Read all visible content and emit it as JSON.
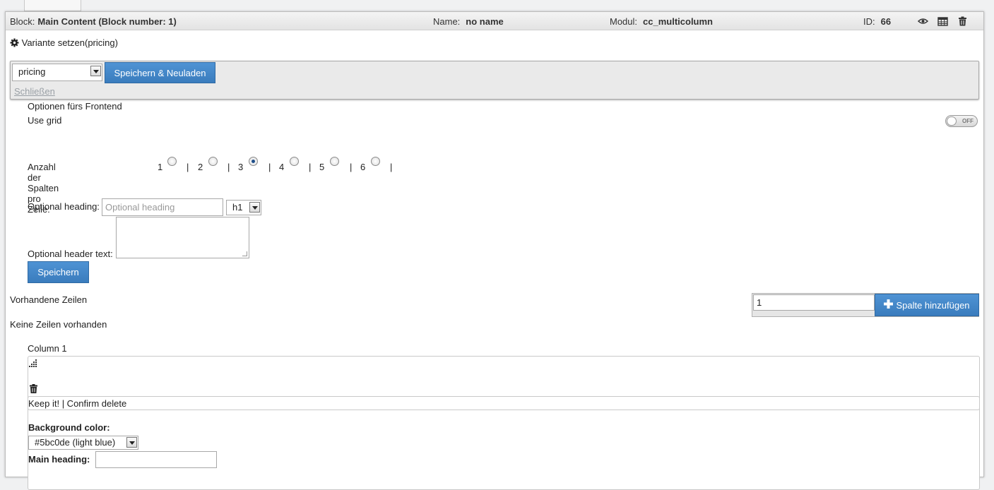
{
  "header": {
    "block_label": "Block:",
    "block_value": "Main Content (Block number: 1)",
    "name_label": "Name:",
    "name_value": "no name",
    "modul_label": "Modul:",
    "modul_value": "cc_multicolumn",
    "id_label": "ID:",
    "id_value": "66",
    "icons": [
      "eye-icon",
      "calendar-icon",
      "trash-icon"
    ]
  },
  "variant": {
    "title": "Variante setzen(pricing)",
    "selected": "pricing",
    "save_reload_label": "Speichern & Neuladen",
    "close_label": "Schließen"
  },
  "options": {
    "frontend_label": "Optionen fürs Frontend",
    "use_grid_label": "Use grid",
    "use_grid_toggle": "OFF",
    "columns_label": "Anzahl der Spalten pro Zeile:",
    "columns_options": [
      "1",
      "2",
      "3",
      "4",
      "5",
      "6"
    ],
    "columns_selected": "3",
    "separator": "|",
    "heading_label": "Optional heading:",
    "heading_placeholder": "Optional heading",
    "heading_level": "h1",
    "header_text_label": "Optional header text:",
    "save_label": "Speichern"
  },
  "rows": {
    "existing_label": "Vorhandene Zeilen",
    "none_label": "Keine Zeilen vorhanden",
    "column_count_value": "1",
    "add_column_label": "Spalte hinzufügen"
  },
  "column": {
    "title": "Column 1",
    "confirm_text": "Keep it! | Confirm delete",
    "bg_color_label": "Background color:",
    "bg_color_value": "#5bc0de (light blue)",
    "main_heading_label": "Main heading:"
  },
  "colors": {
    "accent_blue": "#3a7cbd",
    "panel_bg": "#ffffff",
    "page_bg": "#f0f1f2"
  }
}
